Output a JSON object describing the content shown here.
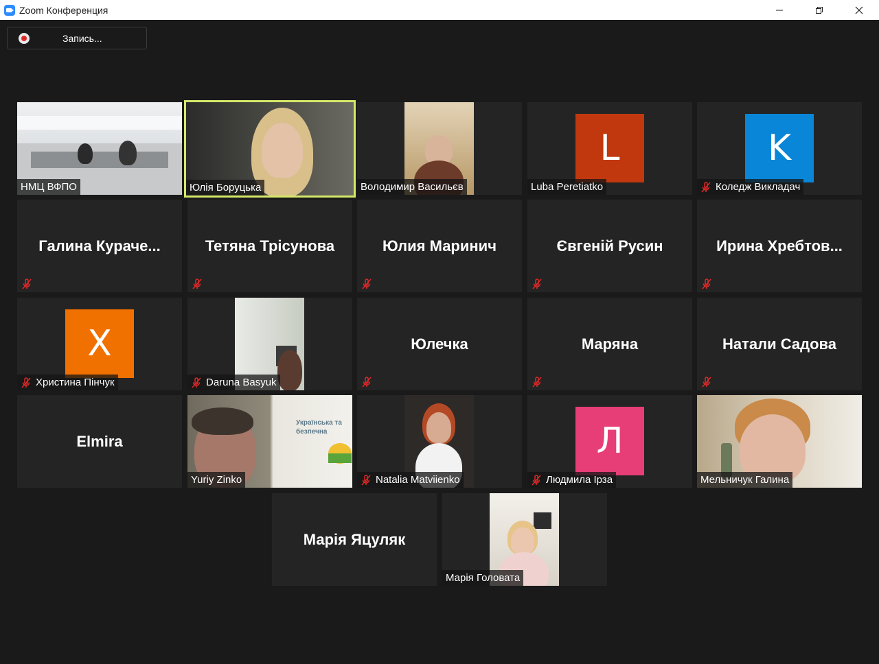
{
  "window": {
    "title": "Zoom Конференция",
    "controls": [
      "minimize-icon",
      "restore-icon",
      "close-icon"
    ]
  },
  "recording": {
    "label": "Запись..."
  },
  "colors": {
    "background": "#1a1a1a",
    "tile": "#242424",
    "active_border": "#d6e86a",
    "mute_icon": "#e02828",
    "avatar_L": "#c1380e",
    "avatar_K": "#0a86d8",
    "avatar_X": "#f07000",
    "avatar_Л": "#e83e78"
  },
  "participants": [
    {
      "name": "НМЦ ВФПО",
      "video": true,
      "muted": false
    },
    {
      "name": "Юлія Боруцька",
      "video": true,
      "muted": false,
      "active_speaker": true
    },
    {
      "name": "Володимир Васильєв",
      "video": true,
      "muted": false
    },
    {
      "name": "Luba Peretiatko",
      "avatar_letter": "L",
      "muted": false
    },
    {
      "name": "Коледж Викладач",
      "avatar_letter": "K",
      "muted": true
    },
    {
      "name": "Галина  Кураче...",
      "muted": true
    },
    {
      "name": "Тетяна Трісунова",
      "muted": true
    },
    {
      "name": "Юлия Маринич",
      "muted": true
    },
    {
      "name": "Євгеній Русин",
      "muted": true
    },
    {
      "name": "Ирина  Хребтов...",
      "muted": true
    },
    {
      "name": "Христина Пінчук",
      "avatar_letter": "X",
      "muted": true
    },
    {
      "name": "Daruna Basyuk",
      "video": true,
      "muted": true
    },
    {
      "name": "Юлечка",
      "muted": true
    },
    {
      "name": "Маряна",
      "muted": true
    },
    {
      "name": "Натали Садова",
      "muted": true
    },
    {
      "name": "Elmira",
      "muted": false
    },
    {
      "name": "Yuriy Zinko",
      "video": true,
      "muted": false
    },
    {
      "name": "Natalia Matviienko",
      "video": true,
      "muted": true
    },
    {
      "name": "Людмила Ірза",
      "avatar_letter": "Л",
      "muted": true
    },
    {
      "name": "Мельничук Галина",
      "video": true,
      "muted": false
    },
    {
      "name": "Марія Яцуляк",
      "muted": false
    },
    {
      "name": "Марія Головата",
      "video": true,
      "muted": false
    }
  ],
  "banner_text": [
    "Українська та безпечна"
  ]
}
